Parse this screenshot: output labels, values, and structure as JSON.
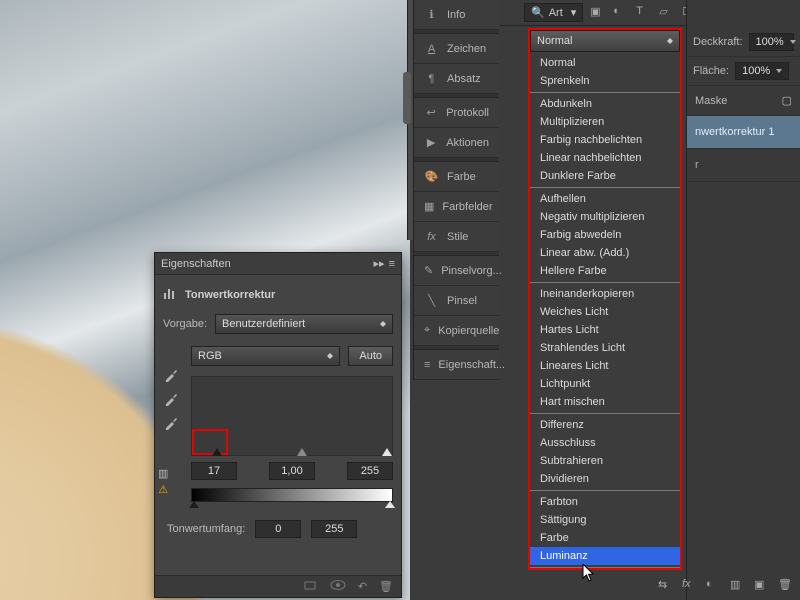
{
  "topbar": {
    "search": "Art"
  },
  "blend": {
    "current": "Normal",
    "groups": [
      [
        "Normal",
        "Sprenkeln"
      ],
      [
        "Abdunkeln",
        "Multiplizieren",
        "Farbig nachbelichten",
        "Linear nachbelichten",
        "Dunklere Farbe"
      ],
      [
        "Aufhellen",
        "Negativ multiplizieren",
        "Farbig abwedeln",
        "Linear abw. (Add.)",
        "Hellere Farbe"
      ],
      [
        "Ineinanderkopieren",
        "Weiches Licht",
        "Hartes Licht",
        "Strahlendes Licht",
        "Lineares Licht",
        "Lichtpunkt",
        "Hart mischen"
      ],
      [
        "Differenz",
        "Ausschluss",
        "Subtrahieren",
        "Dividieren"
      ],
      [
        "Farbton",
        "Sättigung",
        "Farbe",
        "Luminanz"
      ]
    ],
    "selected": "Luminanz"
  },
  "right": {
    "opacity_label": "Deckkraft:",
    "opacity": "100%",
    "fill_label": "Fläche:",
    "fill": "100%",
    "mask": "Maske",
    "layer": "nwertkorrektur 1",
    "extra": "r"
  },
  "side": {
    "info": "Info",
    "zeichen": "Zeichen",
    "absatz": "Absatz",
    "protokoll": "Protokoll",
    "aktionen": "Aktionen",
    "farbe": "Farbe",
    "farbfelder": "Farbfelder",
    "stile": "Stile",
    "pinselvorg": "Pinselvorg...",
    "pinsel": "Pinsel",
    "kopierquelle": "Kopierquelle",
    "eigenschaft": "Eigenschaft..."
  },
  "props": {
    "title": "Eigenschaften",
    "sub": "Tonwertkorrektur",
    "preset_label": "Vorgabe:",
    "preset": "Benutzerdefiniert",
    "channel": "RGB",
    "auto": "Auto",
    "blk": "17",
    "mid": "1,00",
    "wht": "255",
    "range_label": "Tonwertumfang:",
    "out_blk": "0",
    "out_wht": "255"
  }
}
